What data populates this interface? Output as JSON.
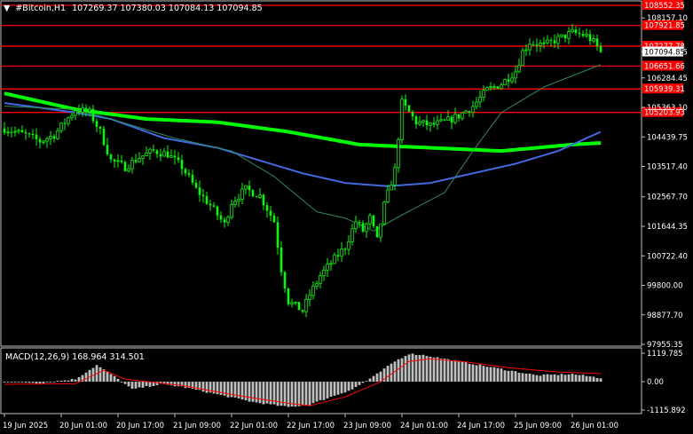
{
  "window": {
    "title": "#Bitcoin,H1",
    "ohlc": "107269.37 107380.03 107084.13 107094.85"
  },
  "colors": {
    "background": "#000000",
    "frame": "#c0c0c0",
    "bull": "#00ff00",
    "bear": "#00ff00",
    "level": "#ff0000",
    "ma_slow": "#00ff00",
    "ma_mid": "#4169e1",
    "ma_fast": "#2e8b57",
    "macd_hist": "#c0c0c0",
    "macd_signal": "#ff0000",
    "text": "#ffffff"
  },
  "chart_data": [
    {
      "type": "candlestick",
      "symbol": "#Bitcoin",
      "timeframe": "H1",
      "ylim": [
        97955.35,
        108552.35
      ],
      "price_ticks": [
        "108157.10",
        "107094.85",
        "106284.45",
        "105363.10",
        "104439.75",
        "103517.40",
        "102567.70",
        "101644.35",
        "100722.40",
        "99800.00",
        "98877.70",
        "97955.35"
      ],
      "price_tick_values": [
        108157.1,
        107094.85,
        106284.45,
        105363.1,
        104439.75,
        103517.4,
        102567.7,
        101644.35,
        100722.4,
        99800.0,
        98877.7,
        97955.35
      ],
      "time_labels": [
        "19 Jun 2025",
        "20 Jun 01:00",
        "20 Jun 17:00",
        "21 Jun 09:00",
        "22 Jun 01:00",
        "22 Jun 17:00",
        "23 Jun 09:00",
        "24 Jun 01:00",
        "24 Jun 17:00",
        "25 Jun 09:00",
        "26 Jun 01:00"
      ],
      "time_label_index": [
        0,
        16,
        32,
        48,
        64,
        80,
        96,
        112,
        128,
        144,
        160
      ],
      "levels": [
        {
          "label": "108552.35",
          "value": 108552.35
        },
        {
          "label": "107921.85",
          "value": 107921.85
        },
        {
          "label": "107277.78",
          "value": 107277.78
        },
        {
          "label": "106651.66",
          "value": 106651.66
        },
        {
          "label": "105939.31",
          "value": 105939.31
        },
        {
          "label": "105203.93",
          "value": 105203.93
        }
      ],
      "current_price": {
        "label": "107094.85",
        "value": 107094.85
      },
      "close_anchors": [
        [
          0,
          104700
        ],
        [
          6,
          104500
        ],
        [
          10,
          104300
        ],
        [
          14,
          104500
        ],
        [
          17,
          104900
        ],
        [
          20,
          105300
        ],
        [
          24,
          105200
        ],
        [
          27,
          104600
        ],
        [
          30,
          103700
        ],
        [
          34,
          103500
        ],
        [
          38,
          103800
        ],
        [
          42,
          104000
        ],
        [
          46,
          103900
        ],
        [
          50,
          103500
        ],
        [
          54,
          102800
        ],
        [
          58,
          102300
        ],
        [
          62,
          101700
        ],
        [
          64,
          102400
        ],
        [
          68,
          102800
        ],
        [
          72,
          102600
        ],
        [
          76,
          101800
        ],
        [
          78,
          100300
        ],
        [
          80,
          99300
        ],
        [
          84,
          99000
        ],
        [
          86,
          99500
        ],
        [
          89,
          100100
        ],
        [
          92,
          100500
        ],
        [
          96,
          101000
        ],
        [
          99,
          101800
        ],
        [
          101,
          101500
        ],
        [
          103,
          101900
        ],
        [
          105,
          101200
        ],
        [
          107,
          102300
        ],
        [
          110,
          103400
        ],
        [
          112,
          105500
        ],
        [
          116,
          104900
        ],
        [
          120,
          104800
        ],
        [
          124,
          104900
        ],
        [
          128,
          105100
        ],
        [
          132,
          105400
        ],
        [
          136,
          105900
        ],
        [
          140,
          106100
        ],
        [
          144,
          106500
        ],
        [
          146,
          107100
        ],
        [
          148,
          107400
        ],
        [
          152,
          107300
        ],
        [
          156,
          107500
        ],
        [
          160,
          107700
        ],
        [
          164,
          107600
        ],
        [
          166,
          107400
        ],
        [
          168,
          107094.85
        ]
      ],
      "moving_averages": [
        {
          "name": "MA slow",
          "color": "#00ff00",
          "width": 4,
          "anchors": [
            [
              0,
              105800
            ],
            [
              20,
              105300
            ],
            [
              40,
              105000
            ],
            [
              60,
              104900
            ],
            [
              80,
              104600
            ],
            [
              100,
              104200
            ],
            [
              120,
              104100
            ],
            [
              140,
              104000
            ],
            [
              160,
              104200
            ],
            [
              168,
              104250
            ]
          ]
        },
        {
          "name": "MA mid",
          "color": "#4169e1",
          "width": 2,
          "anchors": [
            [
              0,
              105500
            ],
            [
              20,
              105200
            ],
            [
              30,
              105000
            ],
            [
              45,
              104400
            ],
            [
              60,
              104100
            ],
            [
              72,
              103700
            ],
            [
              84,
              103300
            ],
            [
              96,
              103000
            ],
            [
              108,
              102900
            ],
            [
              120,
              103000
            ],
            [
              132,
              103300
            ],
            [
              144,
              103600
            ],
            [
              156,
              104000
            ],
            [
              168,
              104600
            ]
          ]
        },
        {
          "name": "MA fast",
          "color": "#2e8b57",
          "width": 1,
          "anchors": [
            [
              0,
              105400
            ],
            [
              20,
              105300
            ],
            [
              30,
              105000
            ],
            [
              48,
              104400
            ],
            [
              64,
              104000
            ],
            [
              76,
              103200
            ],
            [
              88,
              102100
            ],
            [
              96,
              101900
            ],
            [
              104,
              101500
            ],
            [
              112,
              102000
            ],
            [
              124,
              102700
            ],
            [
              132,
              104000
            ],
            [
              140,
              105200
            ],
            [
              152,
              106000
            ],
            [
              168,
              106700
            ]
          ]
        }
      ]
    },
    {
      "type": "macd",
      "label": "MACD(12,26,9) 168.964 314.501",
      "ylim": [
        -1115.892,
        1119.785
      ],
      "ticks": [
        "1119.785",
        "0.00",
        "-1115.892"
      ],
      "tick_values": [
        1119.785,
        0,
        -1115.892
      ],
      "histogram_anchors": [
        [
          0,
          0
        ],
        [
          10,
          -50
        ],
        [
          20,
          100
        ],
        [
          26,
          650
        ],
        [
          30,
          300
        ],
        [
          36,
          -300
        ],
        [
          44,
          -100
        ],
        [
          50,
          -200
        ],
        [
          60,
          -500
        ],
        [
          70,
          -800
        ],
        [
          80,
          -1000
        ],
        [
          86,
          -900
        ],
        [
          92,
          -600
        ],
        [
          98,
          -300
        ],
        [
          104,
          200
        ],
        [
          110,
          800
        ],
        [
          114,
          1100
        ],
        [
          118,
          1050
        ],
        [
          124,
          900
        ],
        [
          130,
          750
        ],
        [
          140,
          500
        ],
        [
          150,
          250
        ],
        [
          160,
          300
        ],
        [
          168,
          150
        ]
      ],
      "signal_anchors": [
        [
          0,
          -100
        ],
        [
          20,
          -80
        ],
        [
          28,
          450
        ],
        [
          34,
          100
        ],
        [
          50,
          -150
        ],
        [
          66,
          -550
        ],
        [
          80,
          -850
        ],
        [
          86,
          -950
        ],
        [
          96,
          -600
        ],
        [
          106,
          0
        ],
        [
          114,
          800
        ],
        [
          120,
          900
        ],
        [
          130,
          780
        ],
        [
          142,
          550
        ],
        [
          156,
          380
        ],
        [
          168,
          320
        ]
      ]
    }
  ]
}
